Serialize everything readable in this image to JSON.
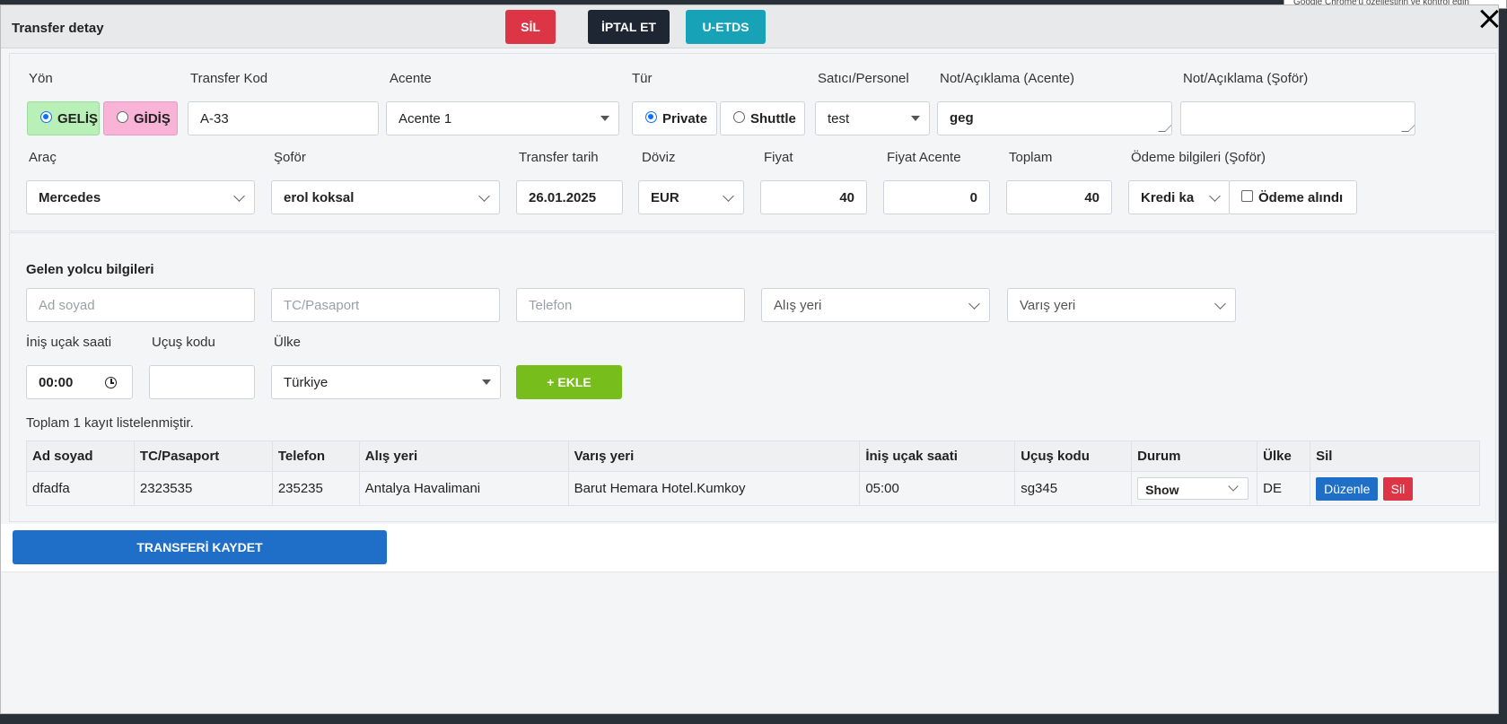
{
  "tooltip_fragment": "Google Chrome'u özelleştirin ve kontrol edin",
  "dialog": {
    "title": "Transfer detay",
    "buttons": {
      "sil": "SİL",
      "iptal": "İPTAL ET",
      "etds": "U-ETDS"
    }
  },
  "form": {
    "labels": {
      "yon": "Yön",
      "transfer_kod": "Transfer Kod",
      "acente": "Acente",
      "tur": "Tür",
      "satici": "Satıcı/Personel",
      "not_acente": "Not/Açıklama (Acente)",
      "not_sofor": "Not/Açıklama (Şoför)",
      "arac": "Araç",
      "sofor": "Şoför",
      "transfer_tarih": "Transfer tarih",
      "doviz": "Döviz",
      "fiyat": "Fiyat",
      "fiyat_acente": "Fiyat Acente",
      "toplam": "Toplam",
      "odeme": "Ödeme bilgileri (Şoför)"
    },
    "yon": {
      "gelis": "GELİŞ",
      "gidis": "GİDİŞ"
    },
    "transfer_kod": "A-33",
    "acente": "Acente 1",
    "tur": {
      "private": "Private",
      "shuttle": "Shuttle"
    },
    "satici": "test",
    "not_acente": "geg",
    "not_sofor": "",
    "arac": "Mercedes",
    "sofor": "erol koksal",
    "transfer_tarih": "26.01.2025",
    "doviz": "EUR",
    "fiyat": "40",
    "fiyat_acente": "0",
    "toplam": "40",
    "odeme_tipi": "Kredi ka",
    "odeme_alindi": "Ödeme alındı"
  },
  "passenger": {
    "title": "Gelen yolcu bilgileri",
    "placeholders": {
      "ad_soyad": "Ad soyad",
      "tc": "TC/Pasaport",
      "telefon": "Telefon",
      "alis_yeri": "Alış yeri",
      "varis_yeri": "Varış yeri"
    },
    "labels": {
      "inis": "İniş uçak saati",
      "ucus": "Uçuş kodu",
      "ulke": "Ülke"
    },
    "inis_saati": "00:00",
    "ucus_kodu": "",
    "ulke": "Türkiye",
    "ekle": "+ EKLE",
    "count_text": "Toplam 1 kayıt listelenmiştir."
  },
  "table": {
    "headers": [
      "Ad soyad",
      "TC/Pasaport",
      "Telefon",
      "Alış yeri",
      "Varış yeri",
      "İniş uçak saati",
      "Uçuş kodu",
      "Durum",
      "Ülke",
      "Sil"
    ],
    "rows": [
      {
        "ad": "dfadfa",
        "tc": "2323535",
        "tel": "235235",
        "alis": "Antalya Havalimani",
        "varis": "Barut Hemara Hotel.Kumkoy",
        "inis": "05:00",
        "ucus": "sg345",
        "durum": "Show",
        "ulke": "DE",
        "duzenle": "Düzenle",
        "sil": "Sil"
      }
    ]
  },
  "save_button": "TRANSFERİ KAYDET"
}
